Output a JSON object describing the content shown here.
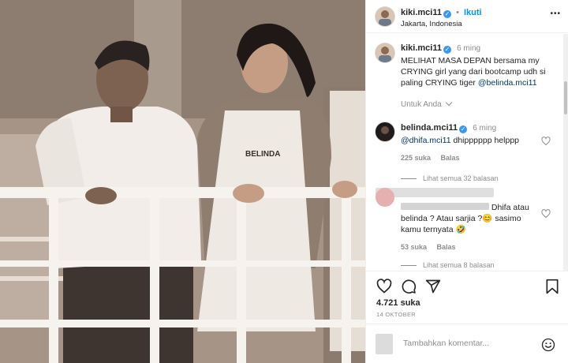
{
  "header": {
    "username": "kiki.mci11",
    "follow_label": "Ikuti",
    "separator": "•",
    "location": "Jakarta, Indonesia",
    "more": "•••"
  },
  "caption": {
    "username": "kiki.mci11",
    "time": "6 ming",
    "text": "MELIHAT MASA DEPAN bersama my CRYING girl yang dari bootcamp udh si paling CRYING tiger",
    "mention": "@belinda.mci11",
    "translate": "Untuk Anda"
  },
  "comments": [
    {
      "username": "belinda.mci11",
      "time": "6 ming",
      "mention": "@dhifa.mci11",
      "text": " dhipppppp helppp",
      "likes": "225 suka",
      "reply": "Balas",
      "view_replies": "Lihat semua 32 balasan"
    },
    {
      "username": "",
      "text_line1": "Dhifa atau",
      "text_line2": "belinda ? Atau sarjia ?",
      "text_line3": "sasimo",
      "text_line4": "kamu ternyata",
      "emoji1": "😊",
      "emoji2": "🤣",
      "likes": "53 suka",
      "reply": "Balas",
      "view_replies": "Lihat semua 8 balasan"
    }
  ],
  "footer": {
    "likes": "4.721 suka",
    "date": "14 OKTOBER",
    "placeholder": "Tambahkan komentar..."
  },
  "photo": {
    "apron_text": "BELINDA"
  },
  "icons": {
    "heart": "heart-icon",
    "comment": "comment-icon",
    "share": "share-icon",
    "save": "bookmark-icon",
    "emoji": "emoji-icon",
    "verified": "verified-icon"
  },
  "colors": {
    "accent": "#0095f6",
    "verified": "#3897f0"
  }
}
